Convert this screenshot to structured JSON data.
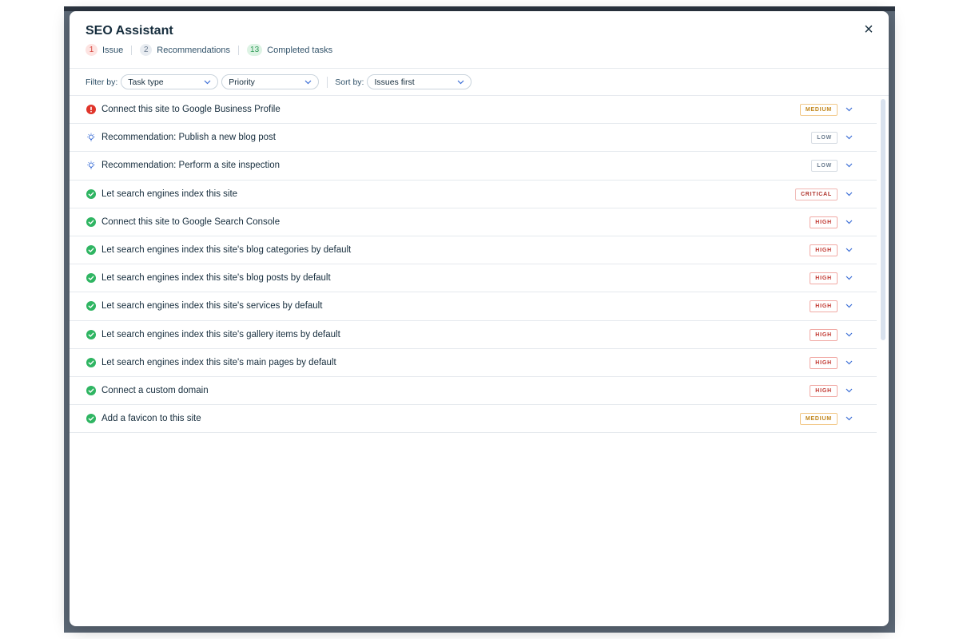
{
  "modal": {
    "title": "SEO Assistant",
    "close_label": "×",
    "summary": {
      "issue_count": "1",
      "issue_label": "Issue",
      "rec_count": "2",
      "rec_label": "Recommendations",
      "done_count": "13",
      "done_label": "Completed tasks"
    }
  },
  "filters": {
    "filter_label": "Filter by:",
    "task_type": "Task type",
    "priority": "Priority",
    "sort_label": "Sort by:",
    "sort_value": "Issues first"
  },
  "tasks": [
    {
      "title": "Connect this site to Google Business Profile",
      "status": "issue",
      "priority": "MEDIUM"
    },
    {
      "title": "Recommendation: Publish a new blog post",
      "status": "recommendation",
      "priority": "LOW"
    },
    {
      "title": "Recommendation: Perform a site inspection",
      "status": "recommendation",
      "priority": "LOW"
    },
    {
      "title": "Let search engines index this site",
      "status": "completed",
      "priority": "CRITICAL"
    },
    {
      "title": "Connect this site to Google Search Console",
      "status": "completed",
      "priority": "HIGH"
    },
    {
      "title": "Let search engines index this site's blog categories by default",
      "status": "completed",
      "priority": "HIGH"
    },
    {
      "title": "Let search engines index this site's blog posts by default",
      "status": "completed",
      "priority": "HIGH"
    },
    {
      "title": "Let search engines index this site's services by default",
      "status": "completed",
      "priority": "HIGH"
    },
    {
      "title": "Let search engines index this site's gallery items by default",
      "status": "completed",
      "priority": "HIGH"
    },
    {
      "title": "Let search engines index this site's main pages by default",
      "status": "completed",
      "priority": "HIGH"
    },
    {
      "title": "Connect a custom domain",
      "status": "completed",
      "priority": "HIGH"
    },
    {
      "title": "Add a favicon to this site",
      "status": "completed",
      "priority": "MEDIUM"
    }
  ],
  "icons": {
    "issue": "alert-circle-icon",
    "recommendation": "lightbulb-icon",
    "completed": "check-circle-icon",
    "expand": "chevron-down-icon",
    "dropdown": "chevron-down-icon"
  },
  "colors": {
    "issue": "#e0352b",
    "recommendation": "#3b6ed6",
    "completed": "#2fb562",
    "accent": "#3b6ed6"
  }
}
